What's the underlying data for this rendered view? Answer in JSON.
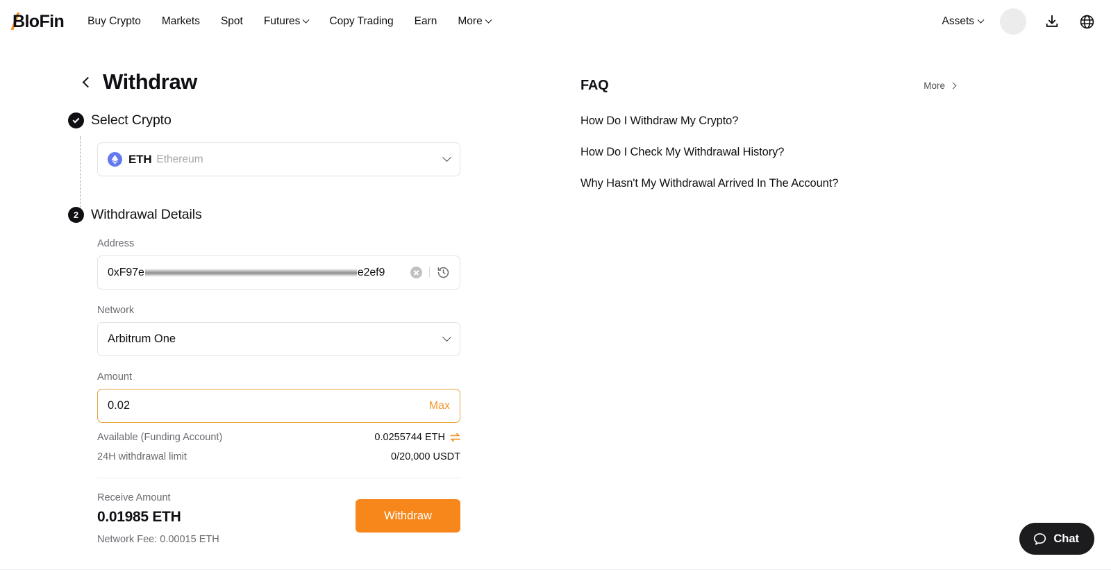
{
  "header": {
    "logo": "BloFin",
    "nav": [
      {
        "label": "Buy Crypto",
        "caret": false
      },
      {
        "label": "Markets",
        "caret": false
      },
      {
        "label": "Spot",
        "caret": false
      },
      {
        "label": "Futures",
        "caret": true
      },
      {
        "label": "Copy Trading",
        "caret": false
      },
      {
        "label": "Earn",
        "caret": false
      },
      {
        "label": "More",
        "caret": true
      }
    ],
    "assets_label": "Assets",
    "icons": {
      "avatar": "avatar-placeholder",
      "download": "download-icon",
      "language": "globe-icon"
    }
  },
  "page": {
    "title": "Withdraw",
    "back": "back-chevron"
  },
  "steps": {
    "step1": {
      "badge": "✓",
      "label": "Select Crypto"
    },
    "step2": {
      "badge": "2",
      "label": "Withdrawal Details"
    }
  },
  "crypto": {
    "symbol": "ETH",
    "name": "Ethereum",
    "icon": "eth-coin-icon",
    "icon_color": "#6379ef"
  },
  "form": {
    "address": {
      "label": "Address",
      "value_prefix": "0xF97e",
      "value_suffix": "e2ef9",
      "redacted": true,
      "clear_icon": "clear-icon",
      "history_icon": "history-icon"
    },
    "network": {
      "label": "Network",
      "value": "Arbitrum One"
    },
    "amount": {
      "label": "Amount",
      "value": "0.02",
      "placeholder": "",
      "max_label": "Max",
      "focused": true,
      "focus_color": "#e8a33d"
    },
    "available": {
      "label": "Available (Funding Account)",
      "value": "0.0255744 ETH",
      "transfer_icon": "transfer-icon"
    },
    "limit": {
      "label": "24H withdrawal limit",
      "value": "0/20,000 USDT"
    },
    "receive": {
      "label": "Receive Amount",
      "amount": "0.01985 ETH",
      "fee": "Network Fee: 0.00015 ETH"
    },
    "submit_label": "Withdraw",
    "submit_color": "#f7871a"
  },
  "faq": {
    "title": "FAQ",
    "more_label": "More",
    "items": [
      "How Do I Withdraw My Crypto?",
      "How Do I Check My Withdrawal History?",
      "Why Hasn't My Withdrawal Arrived In The Account?"
    ]
  },
  "chat": {
    "label": "Chat",
    "icon": "chat-bubble-icon"
  }
}
